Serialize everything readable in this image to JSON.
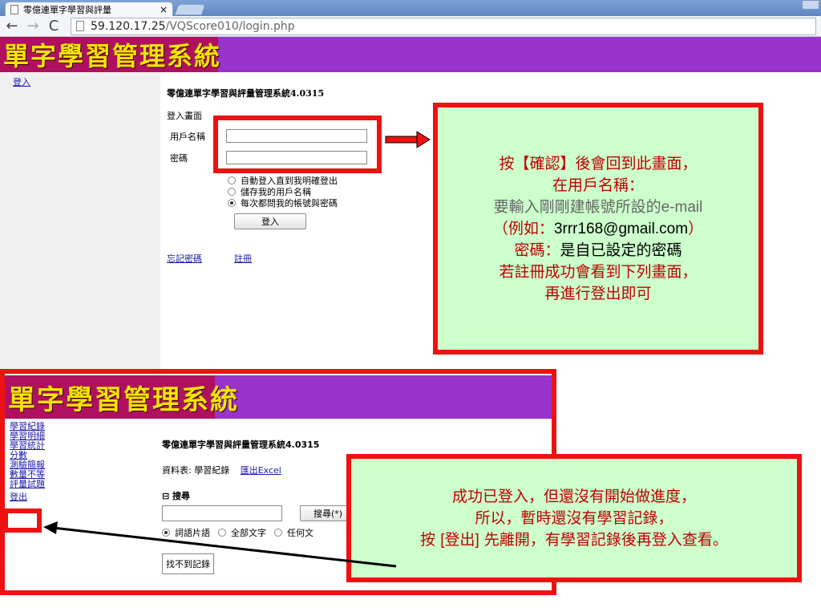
{
  "browser": {
    "tab_title": "零億連單字學習與評量",
    "tab_close": "×",
    "url_host": "59.120.17.25",
    "url_path": "/VQScore010/login.php"
  },
  "site": {
    "logo_text": "單字學習管理系統"
  },
  "login_page": {
    "nav_login": "登入",
    "system_title": "零億連單字學習與評量管理系統4.0315",
    "section_title": "登入畫面",
    "username_label": "用戶名稱",
    "password_label": "密碼",
    "options": [
      {
        "label": "自動登入直到我明確登出",
        "checked": false
      },
      {
        "label": "儲存我的用戶名稱",
        "checked": false
      },
      {
        "label": "每次都問我的帳號與密碼",
        "checked": true
      }
    ],
    "login_button": "登入",
    "forgot_password": "忘記密碼",
    "register": "註冊"
  },
  "note_login": {
    "line1": "按【確認】後會回到此畫面，",
    "line2": "在用戶名稱：",
    "line3_a": "要輸入剛剛建帳號所設的",
    "line3_b": "e-mail",
    "line4_a": "（例如：",
    "line4_b": "3rrr168@gmail.com",
    "line4_c": "）",
    "line5_a": "密碼：",
    "line5_b": "是自已設定的密碼",
    "line6": "若註冊成功會看到下列畫面，",
    "line7": "再進行登出即可"
  },
  "logged_in_page": {
    "nav": [
      "學習紀錄",
      "學習明細",
      "學習統計",
      "分數",
      "測驗簡報",
      "數量不等",
      "評量試題",
      "登出"
    ],
    "system_title": "零億連單字學習與評量管理系統4.0315",
    "table_label": "資料表: 學習紀錄",
    "export_excel": "匯出Excel",
    "search_label": "⊟ 搜尋",
    "search_button": "搜尋(*)",
    "search_options": [
      {
        "label": "詞語片語",
        "checked": true
      },
      {
        "label": "全部文字",
        "checked": false
      },
      {
        "label": "任何文",
        "checked": false
      }
    ],
    "no_records": "找不到記錄"
  },
  "note_logout": {
    "line1": "成功已登入，但還沒有開始做進度，",
    "line2": "所以，暫時還沒有學習記錄，",
    "line3_a": "按 ",
    "line3_b": "[登出]",
    "line3_c": " 先離開，有學習記錄後再登入查看。"
  },
  "colors": {
    "banner_purple": "#9933cc",
    "logo_bg": "#b01060",
    "logo_text": "#f5e400",
    "annotation_red": "#ee1111",
    "note_bg": "#ccffcc",
    "note_text": "#c00000"
  }
}
